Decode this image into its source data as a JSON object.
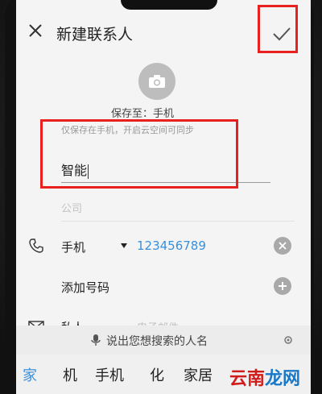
{
  "header": {
    "title": "新建联系人"
  },
  "avatar": {
    "icon": "camera-icon"
  },
  "save_to": {
    "label": "保存至：手机",
    "hint": "仅保存在手机，开启云空间可同步"
  },
  "fields": {
    "name_value": "智能",
    "company_placeholder": "公司"
  },
  "phone_row": {
    "icon": "phone-icon",
    "type": "手机",
    "number": "123456789"
  },
  "add_number": {
    "label": "添加号码"
  },
  "email_row": {
    "icon": "mail-icon",
    "type": "私人",
    "placeholder": "电子邮件"
  },
  "voice": {
    "text": "说出您想搜索的人名"
  },
  "keyboard": {
    "candidates": [
      "家",
      "机",
      "手机",
      "化",
      "家居"
    ]
  },
  "watermark": {
    "part1": "云南",
    "part2": "龙网"
  },
  "colors": {
    "accent": "#3a8fd9",
    "highlight_box": "#e8201f"
  }
}
